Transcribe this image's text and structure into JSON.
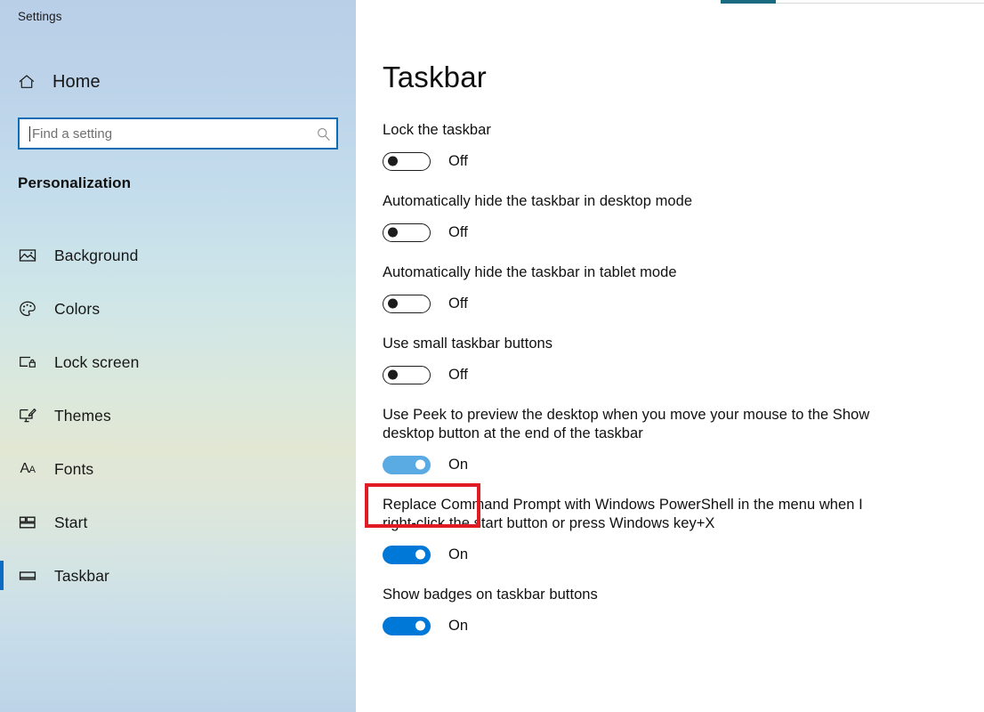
{
  "sidebar": {
    "title": "Settings",
    "home_label": "Home",
    "home_icon": "home-icon",
    "search": {
      "placeholder": "Find a setting",
      "value": "",
      "icon": "search-icon"
    },
    "section_heading": "Personalization",
    "items": [
      {
        "label": "Background",
        "icon": "picture-icon",
        "selected": false
      },
      {
        "label": "Colors",
        "icon": "palette-icon",
        "selected": false
      },
      {
        "label": "Lock screen",
        "icon": "lock-screen-icon",
        "selected": false
      },
      {
        "label": "Themes",
        "icon": "themes-brush-icon",
        "selected": false
      },
      {
        "label": "Fonts",
        "icon": "fonts-aa-icon",
        "selected": false
      },
      {
        "label": "Start",
        "icon": "start-tiles-icon",
        "selected": false
      },
      {
        "label": "Taskbar",
        "icon": "taskbar-icon",
        "selected": true
      }
    ]
  },
  "main": {
    "page_title": "Taskbar",
    "settings": [
      {
        "label": "Lock the taskbar",
        "state": "Off",
        "on": false,
        "highlighted": false
      },
      {
        "label": "Automatically hide the taskbar in desktop mode",
        "state": "Off",
        "on": false,
        "highlighted": false
      },
      {
        "label": "Automatically hide the taskbar in tablet mode",
        "state": "Off",
        "on": false,
        "highlighted": false
      },
      {
        "label": "Use small taskbar buttons",
        "state": "Off",
        "on": false,
        "highlighted": false
      },
      {
        "label": "Use Peek to preview the desktop when you move your mouse to the Show desktop button at the end of the taskbar",
        "state": "On",
        "on": true,
        "highlighted": true
      },
      {
        "label": "Replace Command Prompt with Windows PowerShell in the menu when I right-click the start button or press Windows key+X",
        "state": "On",
        "on": true,
        "highlighted": false
      },
      {
        "label": "Show badges on taskbar buttons",
        "state": "On",
        "on": true,
        "highlighted": false
      }
    ]
  },
  "colors": {
    "accent_blue": "#0078d7",
    "toggle_hover_blue": "#5aaae4",
    "selection_bar": "#0a6cc4",
    "search_border": "#0d6cb4",
    "annotation_red": "#e01b24"
  }
}
